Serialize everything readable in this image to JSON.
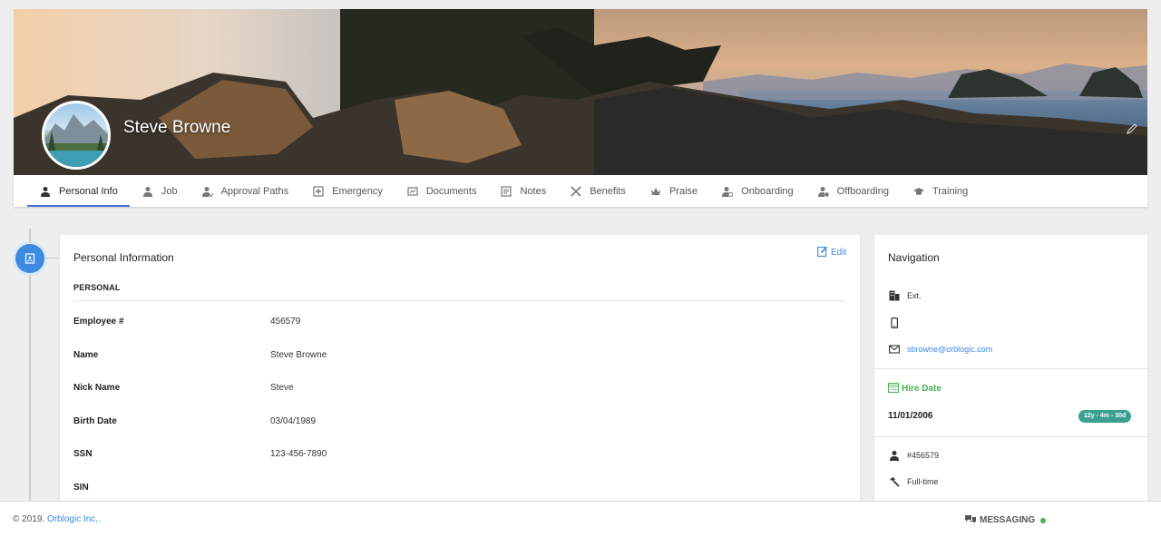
{
  "profile": {
    "name": "Steve Browne"
  },
  "tabs": [
    {
      "label": "Personal Info",
      "icon": "person-icon",
      "active": true
    },
    {
      "label": "Job",
      "icon": "person-icon"
    },
    {
      "label": "Approval Paths",
      "icon": "approval-icon"
    },
    {
      "label": "Emergency",
      "icon": "emergency-icon"
    },
    {
      "label": "Documents",
      "icon": "documents-icon"
    },
    {
      "label": "Notes",
      "icon": "notes-icon"
    },
    {
      "label": "Benefits",
      "icon": "benefits-icon"
    },
    {
      "label": "Praise",
      "icon": "crown-icon"
    },
    {
      "label": "Onboarding",
      "icon": "onboarding-icon"
    },
    {
      "label": "Offboarding",
      "icon": "offboarding-icon"
    },
    {
      "label": "Training",
      "icon": "graduation-cap-icon"
    }
  ],
  "card": {
    "title": "Personal Information",
    "edit_label": "Edit",
    "section": "PERSONAL",
    "fields": [
      {
        "label": "Employee #",
        "value": "456579"
      },
      {
        "label": "Name",
        "value": "Steve Browne"
      },
      {
        "label": "Nick Name",
        "value": "Steve"
      },
      {
        "label": "Birth Date",
        "value": "03/04/1989"
      },
      {
        "label": "SSN",
        "value": "123-456-7890"
      },
      {
        "label": "SIN",
        "value": ""
      }
    ]
  },
  "side": {
    "title": "Navigation",
    "ext_label": "Ext.",
    "email": "sbrowne@orblogic.com",
    "hire_title": "Hire Date",
    "hire_date": "11/01/2006",
    "tenure": "12y - 4m - 30d",
    "employee_id": "#456579",
    "employment_type": "Full-time"
  },
  "footer": {
    "copyright": "© 2019.",
    "company": "Orblogic Inc,.",
    "messaging": "MESSAGING"
  },
  "colors": {
    "accent": "#3d8be0",
    "tab_underline": "#4a72d6",
    "hire_green": "#4caf50",
    "tenure_badge": "#3aa08f"
  }
}
